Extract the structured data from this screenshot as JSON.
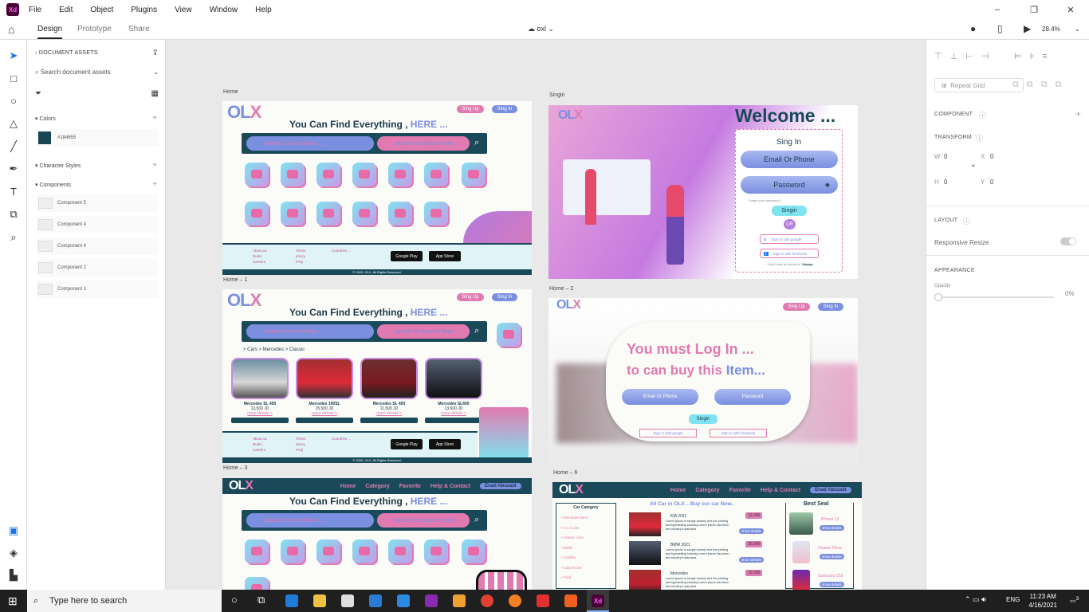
{
  "menu": {
    "items": [
      "File",
      "Edit",
      "Object",
      "Plugins",
      "View",
      "Window",
      "Help"
    ],
    "window_controls": [
      "–",
      "❐",
      "✕"
    ]
  },
  "modes": {
    "tabs": [
      "Design",
      "Prototype",
      "Share"
    ],
    "active": "Design",
    "document_name": "oxl",
    "zoom": "28.4%"
  },
  "assets": {
    "title": "DOCUMENT ASSETS",
    "search_placeholder": "Search document assets",
    "colors_label": "Colors",
    "color_hex": "#184655",
    "character_styles_label": "Character Styles",
    "components_label": "Components",
    "components": [
      "Component 5",
      "Component 4",
      "Component 4",
      "Component 2",
      "Component 1"
    ]
  },
  "artboards": {
    "home": "Home",
    "singin": "Singin",
    "home1": "Home – 1",
    "home2": "Home – 2",
    "home3": "Home – 3",
    "home6": "Home – 6"
  },
  "olx": {
    "logo_a": "OL",
    "logo_b": "X",
    "headline_a": "You Can Find Everything ,",
    "headline_b": "HERE ...",
    "signup": "Sing Up",
    "signin": "Sing In",
    "search_items": "Search for items here ...",
    "search_location": "search for location here ...",
    "footer_col1": "About us\nRules\nCareers",
    "footer_col2": "Terms\nprivcy\nFAQ",
    "countries": "Countries",
    "google_play": "Google Play",
    "app_store": "App Store",
    "copyright": "© 2020, OLX, All Rights Reserved.",
    "breadcrumb": "> Cars > Mercedes > Classic",
    "cars": [
      {
        "name": "Mercedes SL 450",
        "price": "13,500 JD",
        "more": "more details >"
      },
      {
        "name": "Mercedes 190SL",
        "price": "15,500 JD",
        "more": "more details >"
      },
      {
        "name": "Mercedes SL 450",
        "price": "11,500 JD",
        "more": "more details >"
      },
      {
        "name": "Mercedes SL600",
        "price": "13,500 JD",
        "more": "more details >"
      }
    ],
    "nav": [
      "Home",
      "Category",
      "Favorite",
      "Help & Contact"
    ],
    "user": "Enad Abuzaid"
  },
  "singin": {
    "welcome": "Welcome ...",
    "title": "Sing In",
    "email": "Email Or Phone",
    "password": "Password",
    "forgot": "Forget your password?",
    "button": "Singin",
    "or": "OR",
    "google": "Sign in with google",
    "facebook": "Sign in with facebook",
    "no_account": "Don't have an account?",
    "singup": "Singup"
  },
  "modal": {
    "line1": "You must Log In ...",
    "line2a": "to can buy this",
    "line2b": "Item...",
    "email": "Email Or Phone",
    "password": "Password",
    "button": "Singin",
    "google": "Sign in with google",
    "facebook": "Sign in with facebook"
  },
  "home6": {
    "car_category": "Car Category",
    "all_cars": "All Car in OLX .. Buy our car Now..",
    "best_seal": "Best Seal",
    "categories": [
      "Mercedes Benz",
      "4 x 4 cars",
      "Classic Cars",
      "BMW",
      "Cadillac",
      "Land Rover",
      "Ford"
    ],
    "listings": [
      {
        "name": "KIA 2021",
        "price": "12,000"
      },
      {
        "name": "BMW 2021",
        "price": "30,000"
      },
      {
        "name": "Mercedes",
        "price": "10,000"
      }
    ],
    "phones": [
      "iPhone 12",
      "Huawei Nova",
      "Samsung S10"
    ],
    "show_details": "show details",
    "lorem": "Lorem ipsum is simply dummy text the printing and typesetting industry.Lorem ipsum has been the industry's standard"
  },
  "props": {
    "repeat_grid": "Repeat Grid",
    "component": "COMPONENT",
    "transform": "TRANSFORM",
    "w_label": "W",
    "w": "0",
    "x_label": "X",
    "x": "0",
    "h_label": "H",
    "h": "0",
    "y_label": "Y",
    "y": "0",
    "layout": "LAYOUT",
    "responsive": "Responsive Resize",
    "appearance": "APPEARANCE",
    "opacity_label": "Opacity",
    "opacity": "0%"
  },
  "taskbar": {
    "search": "Type here to search",
    "time": "11:23 AM",
    "date": "4/16/2021",
    "lang": "ENG",
    "notifications": "3"
  },
  "colors": {
    "accent": "#1a4a5a",
    "pink": "#e07ab0",
    "blue": "#7a8fe0",
    "xd": "#470137"
  }
}
